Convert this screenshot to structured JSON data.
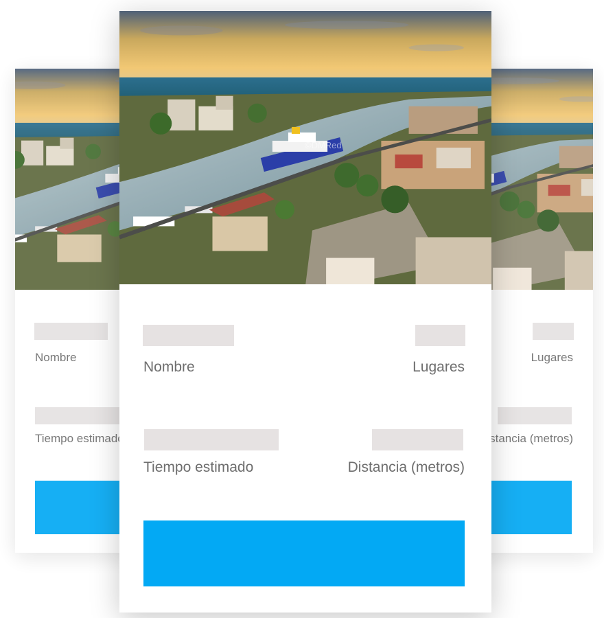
{
  "cards": {
    "left": {
      "labels": {
        "nombre": "Nombre",
        "tiempo": "Tiempo estimado"
      }
    },
    "front": {
      "watermark": "©DMRed",
      "labels": {
        "nombre": "Nombre",
        "lugares": "Lugares",
        "tiempo": "Tiempo estimado",
        "distancia": "Distancia (metros)"
      }
    },
    "right": {
      "labels": {
        "lugares": "Lugares",
        "distancia": "Distancia (metros)"
      }
    }
  },
  "colors": {
    "accent": "#03a9f4",
    "placeholder": "#e6e2e2",
    "label": "#6e6e6e"
  },
  "icons": {
    "photo": "city-harbor-aerial-photo"
  }
}
